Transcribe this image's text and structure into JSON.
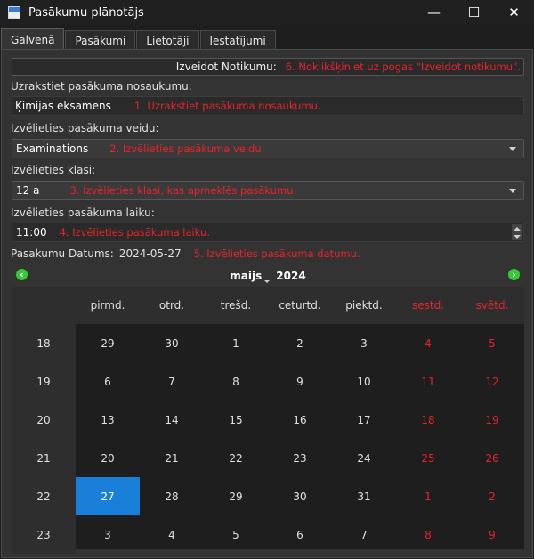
{
  "window": {
    "title": "Pasākumu plānotājs",
    "minimize_symbol": "—",
    "maximize_symbol": "☐",
    "close_symbol": "✕"
  },
  "tabs": [
    {
      "label": "Galvenā",
      "active": true
    },
    {
      "label": "Pasākumi",
      "active": false
    },
    {
      "label": "Lietotāji",
      "active": false
    },
    {
      "label": "Iestatījumi",
      "active": false
    }
  ],
  "form": {
    "create_button_label": "Izveidot Notikumu:",
    "create_note": "6. Noklikšķiniet uz pogas \"Izveidot notikumu\".",
    "name_label": "Uzrakstiet pasākuma nosaukumu:",
    "name_value": "Ķimijas eksamens",
    "name_note": "1. Uzrakstiet pasākuma nosaukumu.",
    "type_label": "Izvēlieties pasākuma veidu:",
    "type_value": "Examinations",
    "type_note": "2. Izvēlieties pasākuma veidu.",
    "class_label": "Izvēlieties klasi:",
    "class_value": "12 a",
    "class_note": "3. Izvēlieties klasi, kas apmeklēs pasākumu.",
    "time_label": "Izvēlieties pasākuma laiku:",
    "time_value": "11:00",
    "time_note": "4. Izvēlieties pasākuma laiku.",
    "date_label": "Pasakumu Datums:",
    "date_value": "2024-05-27",
    "date_note": "5. Izvēlieties pasākuma datumu."
  },
  "calendar": {
    "month": "maijs",
    "year": "2024",
    "prev_symbol": "‹",
    "next_symbol": "›",
    "weekdays": [
      "pirmd.",
      "otrd.",
      "trešd.",
      "ceturtd.",
      "piektd.",
      "sestd.",
      "svētd."
    ],
    "weeks": [
      {
        "wk": "18",
        "days": [
          "29",
          "30",
          "1",
          "2",
          "3",
          "4",
          "5"
        ]
      },
      {
        "wk": "19",
        "days": [
          "6",
          "7",
          "8",
          "9",
          "10",
          "11",
          "12"
        ]
      },
      {
        "wk": "20",
        "days": [
          "13",
          "14",
          "15",
          "16",
          "17",
          "18",
          "19"
        ]
      },
      {
        "wk": "21",
        "days": [
          "20",
          "21",
          "22",
          "23",
          "24",
          "25",
          "26"
        ]
      },
      {
        "wk": "22",
        "days": [
          "27",
          "28",
          "29",
          "30",
          "31",
          "1",
          "2"
        ]
      },
      {
        "wk": "23",
        "days": [
          "3",
          "4",
          "5",
          "6",
          "7",
          "8",
          "9"
        ]
      }
    ],
    "selected": {
      "week": 4,
      "day": 0
    },
    "weekend_color": "#e8232b",
    "selected_color": "#1a7fd9"
  }
}
